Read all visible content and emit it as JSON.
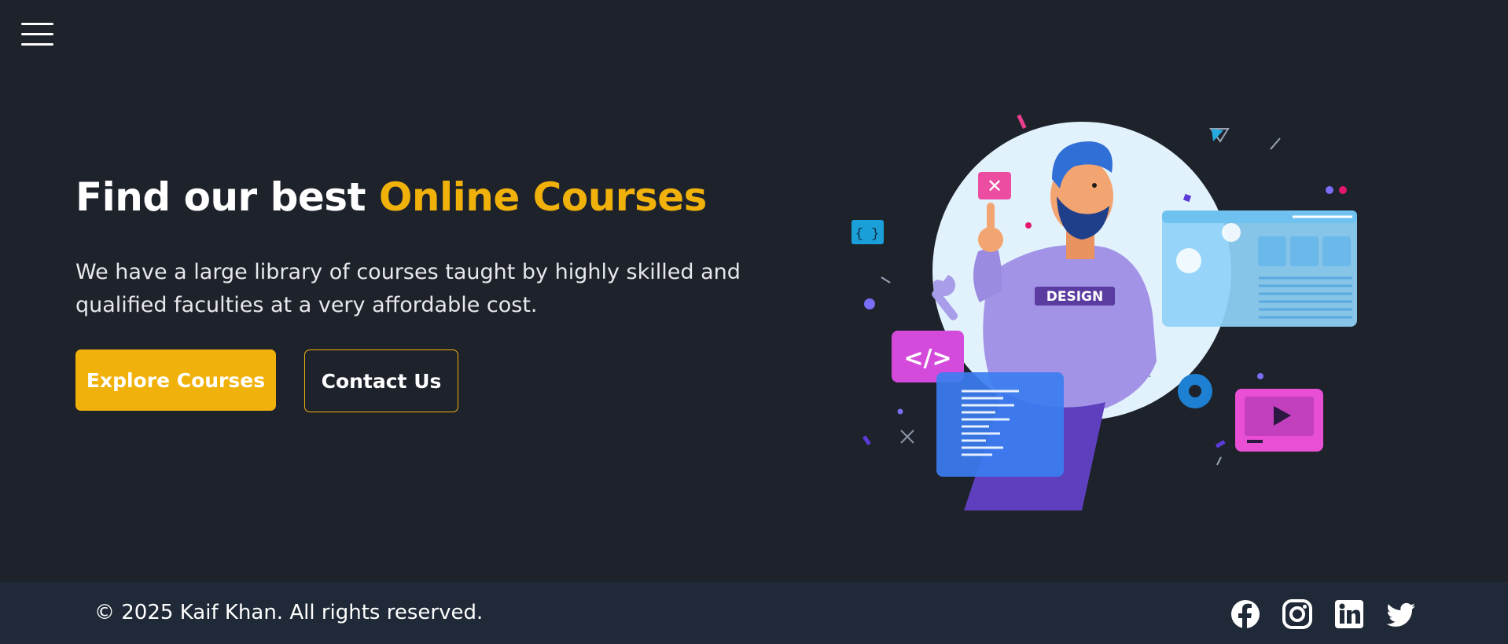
{
  "header": {
    "menu_icon": "hamburger-menu-icon"
  },
  "hero": {
    "title_prefix": "Find our best ",
    "title_highlight": "Online Courses",
    "description": "We have a large library of courses taught by highly skilled and qualified faculties at a very affordable cost.",
    "primary_button": "Explore Courses",
    "secondary_button": "Contact Us",
    "illustration": {
      "shirt_text": "DESIGN",
      "code_badge": "</>",
      "bracket_badge": "{ }"
    }
  },
  "footer": {
    "copyright": "© 2025 Kaif Khan. All rights reserved.",
    "social": [
      {
        "name": "facebook",
        "icon": "facebook-icon"
      },
      {
        "name": "instagram",
        "icon": "instagram-icon"
      },
      {
        "name": "linkedin",
        "icon": "linkedin-icon"
      },
      {
        "name": "twitter",
        "icon": "twitter-icon"
      }
    ]
  },
  "colors": {
    "background": "#1d222b",
    "footer_background": "#1f2937",
    "accent": "#f0b10b",
    "text": "#ffffff"
  }
}
